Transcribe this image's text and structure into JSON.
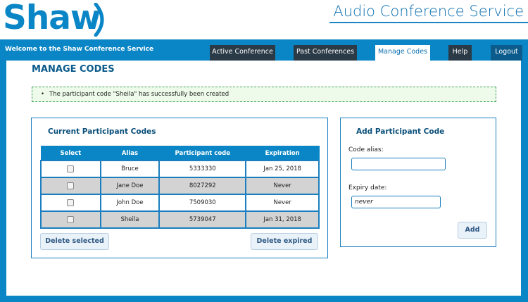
{
  "header": {
    "logo_text": "Shaw",
    "app_title": "Audio Conference Service",
    "brand_color": "#0a86c6"
  },
  "topbar": {
    "welcome": "Welcome to the Shaw Conference Service",
    "tabs": [
      {
        "label": "Active Conference",
        "active": false
      },
      {
        "label": "Past Conferences",
        "active": false
      },
      {
        "label": "Manage Codes",
        "active": true
      },
      {
        "label": "Help",
        "active": false
      },
      {
        "label": "Logout",
        "active": false
      }
    ]
  },
  "main": {
    "page_title": "MANAGE CODES",
    "notice": "The participant code \"Sheila\" has successfully been created"
  },
  "current_codes": {
    "title": "Current Participant Codes",
    "columns": [
      "Select",
      "Alias",
      "Participant code",
      "Expiration"
    ],
    "rows": [
      {
        "alias": "Bruce",
        "code": "5333330",
        "expiration": "Jan 25, 2018"
      },
      {
        "alias": "Jane Doe",
        "code": "8027292",
        "expiration": "Never"
      },
      {
        "alias": "John Doe",
        "code": "7509030",
        "expiration": "Never"
      },
      {
        "alias": "Sheila",
        "code": "5739047",
        "expiration": "Jan 31, 2018"
      }
    ],
    "delete_selected_label": "Delete selected",
    "delete_expired_label": "Delete expired"
  },
  "add_code": {
    "title": "Add Participant Code",
    "alias_label": "Code alias:",
    "alias_value": "",
    "expiry_label": "Expiry date:",
    "expiry_value": "never",
    "add_label": "Add"
  }
}
